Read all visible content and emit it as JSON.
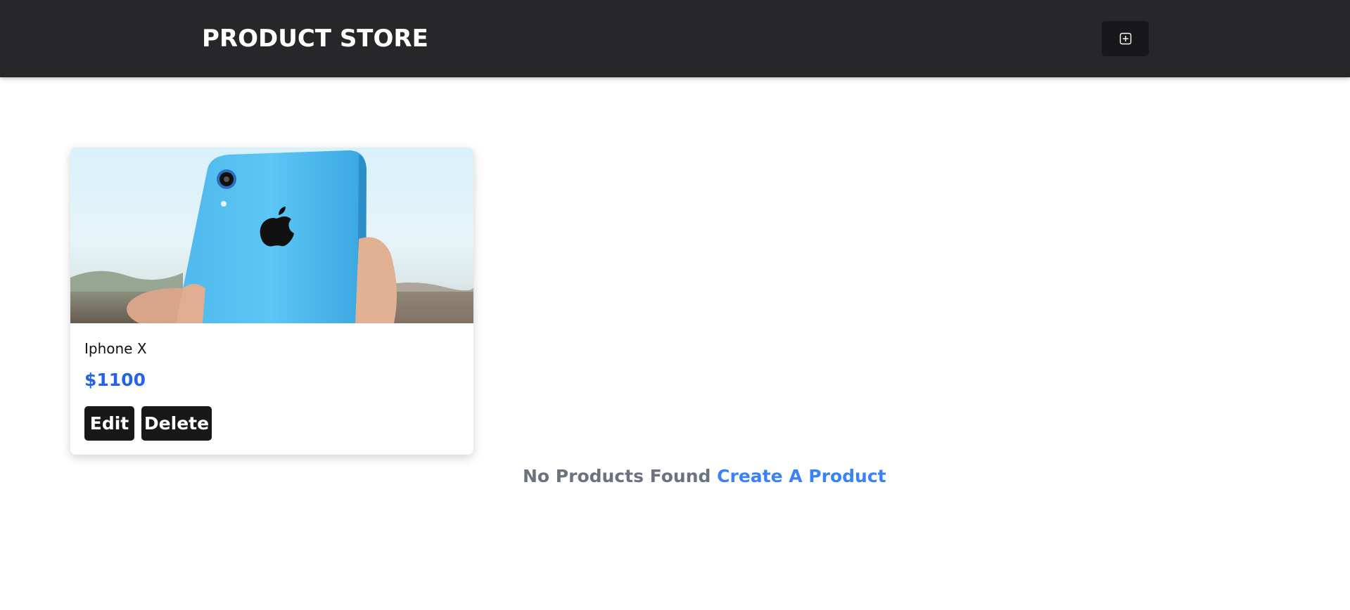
{
  "navbar": {
    "title": "PRODUCT STORE",
    "add_icon": "plus-square-icon"
  },
  "products": [
    {
      "name": "Iphone X",
      "price": "$1100",
      "image": "blue-iphone-in-hand-photo",
      "edit_label": "Edit",
      "delete_label": "Delete"
    }
  ],
  "empty_state": {
    "message": "No Products Found",
    "link_label": "Create A Product"
  },
  "colors": {
    "navbar_bg": "#27272a",
    "button_bg": "#18181b",
    "price": "#2563eb",
    "link": "#3b82f6",
    "muted_text": "#6b7280"
  }
}
